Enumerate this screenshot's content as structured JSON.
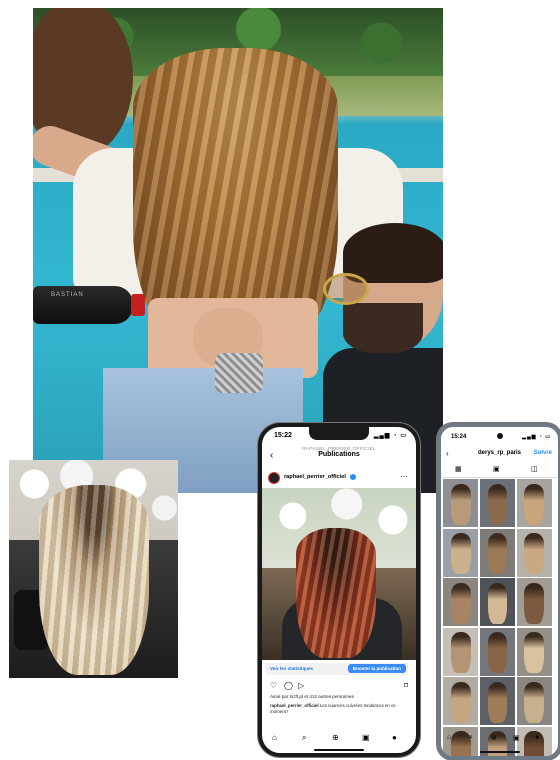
{
  "main_photo": {
    "spray_label": "BASTIAN"
  },
  "phone1": {
    "status": {
      "time": "15:22",
      "icons": "▂▄▆ ◔ ▭"
    },
    "header": {
      "account_caps": "RAPHAEL_PERRIER_OFFICIEL",
      "title": "Publications"
    },
    "post": {
      "username": "raphael_perrier_officiel",
      "stats_label": "Voir les statistiques",
      "boost_label": "Booster la publication",
      "likes": "Aimé par lozft.pl et 412 autres personnes",
      "caption_user": "raphael_perrier_officiel",
      "caption_text": "Les nuances cuivrées tendances en ce moment !"
    },
    "icons": {
      "like": "♡",
      "comment": "◯",
      "share": "▷",
      "save": "⌑"
    },
    "nav": {
      "home": "⌂",
      "search": "⌕",
      "add": "⊕",
      "reels": "▣",
      "profile": "●"
    }
  },
  "phone2": {
    "status": {
      "time": "15:24",
      "icons": "▂▄▆ ◔ ▭"
    },
    "header": {
      "handle": "derys_rp_paris",
      "follow": "Suivre"
    },
    "tabs": {
      "grid": "▦",
      "reels": "▣",
      "tagged": "◫"
    },
    "grid_hair_colors": [
      "#b89a78",
      "#8a6a4c",
      "#c8a57c",
      "#cbb08c",
      "#9c7a58",
      "#c9a882",
      "#a88464",
      "#d2b894",
      "#7a5a40",
      "#b59474",
      "#8a6446",
      "#d8c2a0",
      "#c5a680",
      "#a07c5a",
      "#c8b08e",
      "#9a7250",
      "#bda07e",
      "#6f4c34"
    ],
    "grid_bg_colors": [
      "#8d8f94",
      "#6c7078",
      "#a7a5a0",
      "#9aa0a6",
      "#7d7b78",
      "#b5b2ab",
      "#8b8680",
      "#4f5257",
      "#a29c94",
      "#c4c0b8",
      "#73767c",
      "#949088",
      "#b0aca4",
      "#5d6066",
      "#8a8782",
      "#9e9a92",
      "#6a6d72",
      "#c0bbb3"
    ],
    "nav": {
      "home": "⌂",
      "search": "⌕",
      "add": "⊕",
      "reels": "▣",
      "profile": "●"
    }
  }
}
